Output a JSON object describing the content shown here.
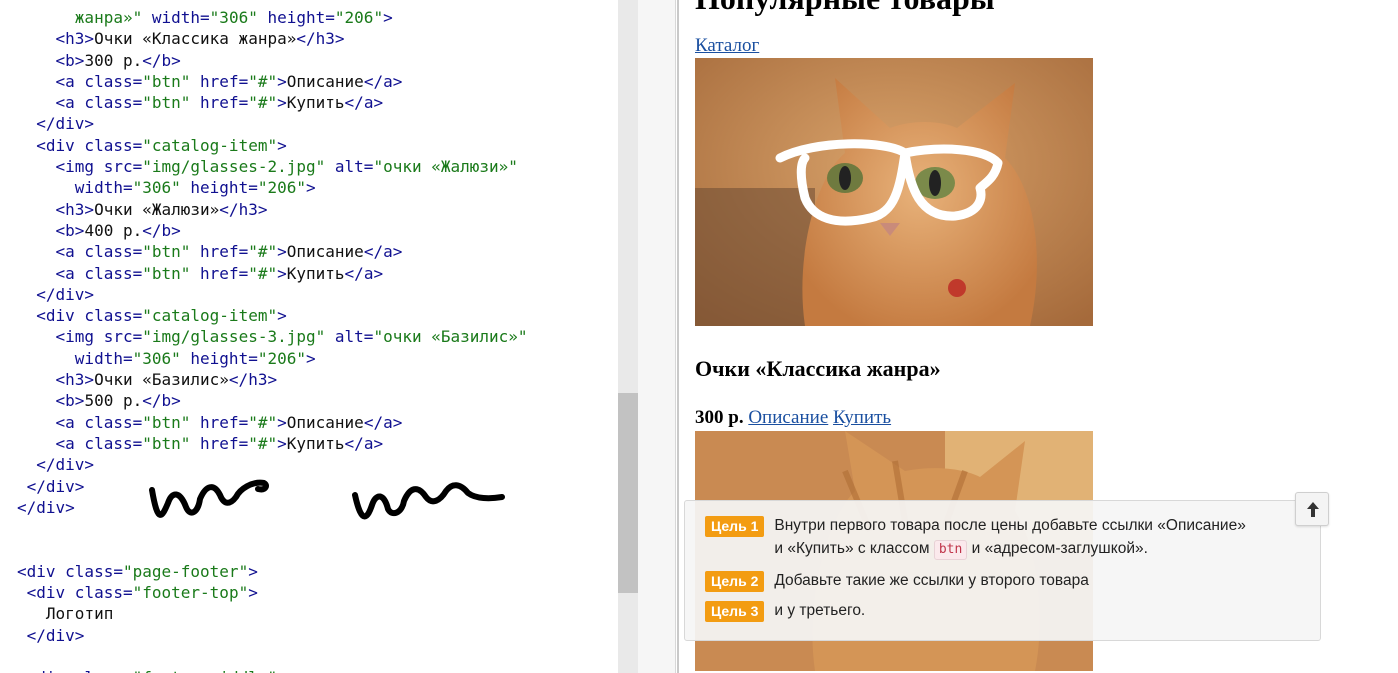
{
  "editor": {
    "lines": [
      [
        [
          "",
          "      "
        ],
        [
          "str",
          "жанра»\""
        ],
        [
          "attr",
          " width="
        ],
        [
          "str",
          "\"306\""
        ],
        [
          "attr",
          " height="
        ],
        [
          "str",
          "\"206\""
        ],
        [
          "tag",
          ">"
        ]
      ],
      [
        [
          "",
          "    "
        ],
        [
          "tag",
          "<h3>"
        ],
        [
          "text",
          "Очки «Классика жанра»"
        ],
        [
          "tag",
          "</h3>"
        ]
      ],
      [
        [
          "",
          "    "
        ],
        [
          "tag",
          "<b>"
        ],
        [
          "text",
          "300 р."
        ],
        [
          "tag",
          "</b>"
        ]
      ],
      [
        [
          "",
          "    "
        ],
        [
          "tag",
          "<a"
        ],
        [
          "attr",
          " class="
        ],
        [
          "str",
          "\"btn\""
        ],
        [
          "attr",
          " href="
        ],
        [
          "str",
          "\"#\""
        ],
        [
          "tag",
          ">"
        ],
        [
          "text",
          "Описание"
        ],
        [
          "tag",
          "</a>"
        ]
      ],
      [
        [
          "",
          "    "
        ],
        [
          "tag",
          "<a"
        ],
        [
          "attr",
          " class="
        ],
        [
          "str",
          "\"btn\""
        ],
        [
          "attr",
          " href="
        ],
        [
          "str",
          "\"#\""
        ],
        [
          "tag",
          ">"
        ],
        [
          "text",
          "Купить"
        ],
        [
          "tag",
          "</a>"
        ]
      ],
      [
        [
          "",
          "  "
        ],
        [
          "tag",
          "</div>"
        ]
      ],
      [
        [
          "",
          "  "
        ],
        [
          "tag",
          "<div"
        ],
        [
          "attr",
          " class="
        ],
        [
          "str",
          "\"catalog-item\""
        ],
        [
          "tag",
          ">"
        ]
      ],
      [
        [
          "",
          "    "
        ],
        [
          "tag",
          "<img"
        ],
        [
          "attr",
          " src="
        ],
        [
          "str",
          "\"img/glasses-2.jpg\""
        ],
        [
          "attr",
          " alt="
        ],
        [
          "str",
          "\"очки «Жалюзи»\""
        ]
      ],
      [
        [
          "",
          "      "
        ],
        [
          "attr",
          "width="
        ],
        [
          "str",
          "\"306\""
        ],
        [
          "attr",
          " height="
        ],
        [
          "str",
          "\"206\""
        ],
        [
          "tag",
          ">"
        ]
      ],
      [
        [
          "",
          "    "
        ],
        [
          "tag",
          "<h3>"
        ],
        [
          "text",
          "Очки «Жалюзи»"
        ],
        [
          "tag",
          "</h3>"
        ]
      ],
      [
        [
          "",
          "    "
        ],
        [
          "tag",
          "<b>"
        ],
        [
          "text",
          "400 р."
        ],
        [
          "tag",
          "</b>"
        ]
      ],
      [
        [
          "",
          "    "
        ],
        [
          "tag",
          "<a"
        ],
        [
          "attr",
          " class="
        ],
        [
          "str",
          "\"btn\""
        ],
        [
          "attr",
          " href="
        ],
        [
          "str",
          "\"#\""
        ],
        [
          "tag",
          ">"
        ],
        [
          "text",
          "Описание"
        ],
        [
          "tag",
          "</a>"
        ]
      ],
      [
        [
          "",
          "    "
        ],
        [
          "tag",
          "<a"
        ],
        [
          "attr",
          " class="
        ],
        [
          "str",
          "\"btn\""
        ],
        [
          "attr",
          " href="
        ],
        [
          "str",
          "\"#\""
        ],
        [
          "tag",
          ">"
        ],
        [
          "text",
          "Купить"
        ],
        [
          "tag",
          "</a>"
        ]
      ],
      [
        [
          "",
          "  "
        ],
        [
          "tag",
          "</div>"
        ]
      ],
      [
        [
          "",
          "  "
        ],
        [
          "tag",
          "<div"
        ],
        [
          "attr",
          " class="
        ],
        [
          "str",
          "\"catalog-item\""
        ],
        [
          "tag",
          ">"
        ]
      ],
      [
        [
          "",
          "    "
        ],
        [
          "tag",
          "<img"
        ],
        [
          "attr",
          " src="
        ],
        [
          "str",
          "\"img/glasses-3.jpg\""
        ],
        [
          "attr",
          " alt="
        ],
        [
          "str",
          "\"очки «Базилис»\""
        ]
      ],
      [
        [
          "",
          "      "
        ],
        [
          "attr",
          "width="
        ],
        [
          "str",
          "\"306\""
        ],
        [
          "attr",
          " height="
        ],
        [
          "str",
          "\"206\""
        ],
        [
          "tag",
          ">"
        ]
      ],
      [
        [
          "",
          "    "
        ],
        [
          "tag",
          "<h3>"
        ],
        [
          "text",
          "Очки «Базилис»"
        ],
        [
          "tag",
          "</h3>"
        ]
      ],
      [
        [
          "",
          "    "
        ],
        [
          "tag",
          "<b>"
        ],
        [
          "text",
          "500 р."
        ],
        [
          "tag",
          "</b>"
        ]
      ],
      [
        [
          "",
          "    "
        ],
        [
          "tag",
          "<a"
        ],
        [
          "attr",
          " class="
        ],
        [
          "str",
          "\"btn\""
        ],
        [
          "attr",
          " href="
        ],
        [
          "str",
          "\"#\""
        ],
        [
          "tag",
          ">"
        ],
        [
          "text",
          "Описание"
        ],
        [
          "tag",
          "</a>"
        ]
      ],
      [
        [
          "",
          "    "
        ],
        [
          "tag",
          "<a"
        ],
        [
          "attr",
          " class="
        ],
        [
          "str",
          "\"btn\""
        ],
        [
          "attr",
          " href="
        ],
        [
          "str",
          "\"#\""
        ],
        [
          "tag",
          ">"
        ],
        [
          "text",
          "Купить"
        ],
        [
          "tag",
          "</a>"
        ]
      ],
      [
        [
          "",
          "  "
        ],
        [
          "tag",
          "</div>"
        ]
      ],
      [
        [
          "",
          " "
        ],
        [
          "tag",
          "</div>"
        ]
      ],
      [
        [
          "tag",
          "</div>"
        ]
      ],
      [
        [
          "",
          ""
        ]
      ],
      [
        [
          "",
          ""
        ]
      ],
      [
        [
          "tag",
          "<div"
        ],
        [
          "attr",
          " class="
        ],
        [
          "str",
          "\"page-footer\""
        ],
        [
          "tag",
          ">"
        ]
      ],
      [
        [
          "",
          " "
        ],
        [
          "tag",
          "<div"
        ],
        [
          "attr",
          " class="
        ],
        [
          "str",
          "\"footer-top\""
        ],
        [
          "tag",
          ">"
        ]
      ],
      [
        [
          "",
          "   "
        ],
        [
          "text",
          "Логотип"
        ]
      ],
      [
        [
          "",
          " "
        ],
        [
          "tag",
          "</div>"
        ]
      ],
      [
        [
          "",
          ""
        ]
      ],
      [
        [
          "",
          " "
        ],
        [
          "tag",
          "<div"
        ],
        [
          "attr",
          " class="
        ],
        [
          "str",
          "\"footer-middle\""
        ],
        [
          "tag",
          ">"
        ]
      ]
    ]
  },
  "preview": {
    "heading": "Популярные товары",
    "catalog_link": "Каталог",
    "product_title": "Очки «Классика жанра»",
    "price": "300 р.",
    "link_description": "Описание",
    "link_buy": "Купить"
  },
  "tasks": {
    "goal1_badge": "Цель 1",
    "goal1_text_a": "Внутри первого товара после цены добавьте ссылки «Описание»",
    "goal1_text_b": "и «Купить» с классом",
    "goal1_code": "btn",
    "goal1_text_c": "и «адресом-заглушкой».",
    "goal2_badge": "Цель 2",
    "goal2_text": "Добавьте такие же ссылки у второго товара",
    "goal3_badge": "Цель 3",
    "goal3_text": "и у третьего."
  },
  "colors": {
    "badge": "#f39c12",
    "link": "#1a4fa0",
    "code_tag": "#101090",
    "code_string": "#1a7a1a"
  }
}
